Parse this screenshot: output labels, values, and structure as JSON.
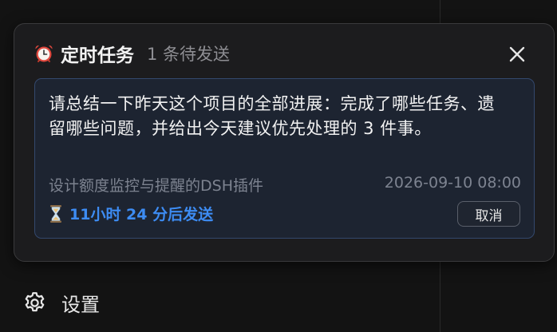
{
  "popover": {
    "title": "定时任务",
    "subtitle": "1 条待发送"
  },
  "task": {
    "prompt": "请总结一下昨天这个项目的全部进展：完成了哪些任务、遗留哪些问题，并给出今天建议优先处理的 3 件事。",
    "project": "设计额度监控与提醒的DSH插件",
    "scheduled_time": "2026-09-10 08:00",
    "countdown": "11小时 24 分后发送",
    "cancel_label": "取消"
  },
  "sidebar": {
    "settings_label": "设置"
  },
  "icons": {
    "header": "alarm-clock-icon",
    "close": "close-icon",
    "countdown": "hourglass-icon",
    "settings": "gear-icon"
  },
  "colors": {
    "accent": "#3d8cf3",
    "card_border": "#33486d",
    "clock_red": "#e0483e"
  }
}
